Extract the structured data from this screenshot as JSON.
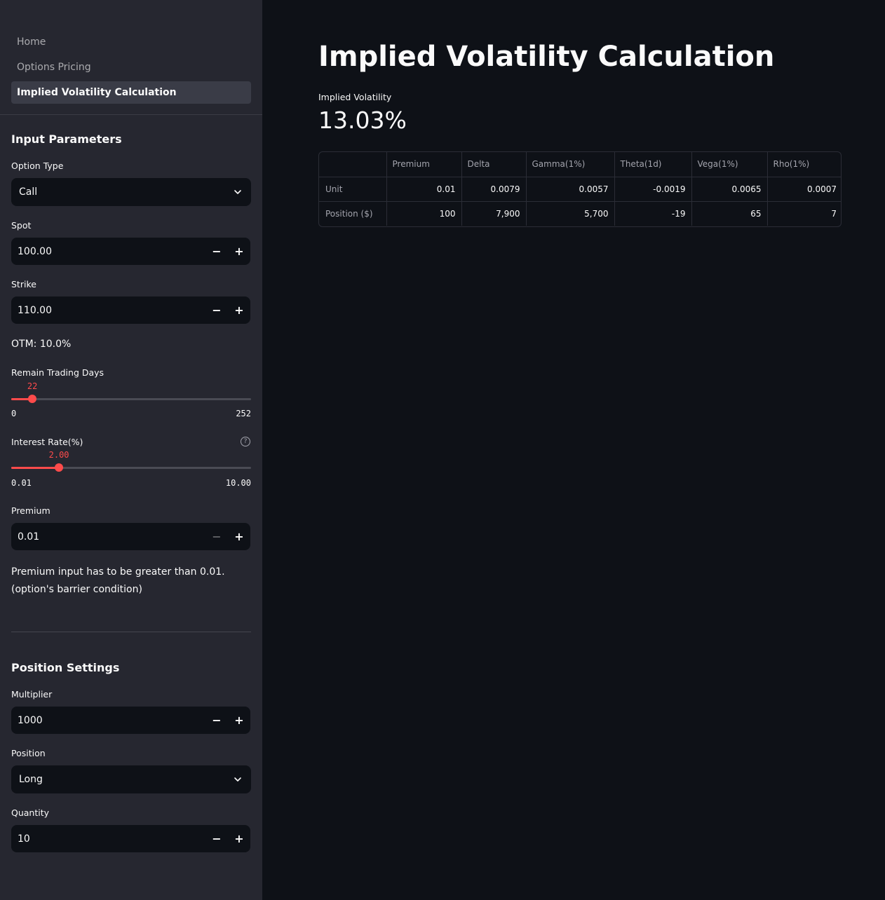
{
  "sidebar": {
    "nav": [
      {
        "label": "Home",
        "active": false
      },
      {
        "label": "Options Pricing",
        "active": false
      },
      {
        "label": "Implied Volatility Calculation",
        "active": true
      }
    ],
    "input_parameters_title": "Input Parameters",
    "option_type": {
      "label": "Option Type",
      "value": "Call"
    },
    "spot": {
      "label": "Spot",
      "value": "100.00"
    },
    "strike": {
      "label": "Strike",
      "value": "110.00"
    },
    "otm_text": "OTM: 10.0%",
    "remain_days": {
      "label": "Remain Trading Days",
      "value": "22",
      "min": "0",
      "max": "252",
      "fraction": 0.0873
    },
    "interest_rate": {
      "label": "Interest Rate(%)",
      "value": "2.00",
      "min": "0.01",
      "max": "10.00",
      "fraction": 0.1992
    },
    "premium": {
      "label": "Premium",
      "value": "0.01"
    },
    "premium_note_line1": "Premium input has to be greater than 0.01.",
    "premium_note_line2": "(option's barrier condition)",
    "position_settings_title": "Position Settings",
    "multiplier": {
      "label": "Multiplier",
      "value": "1000"
    },
    "position": {
      "label": "Position",
      "value": "Long"
    },
    "quantity": {
      "label": "Quantity",
      "value": "10"
    }
  },
  "main": {
    "title": "Implied Volatility Calculation",
    "metric_label": "Implied Volatility",
    "metric_value": "13.03%",
    "table": {
      "columns": [
        "",
        "Premium",
        "Delta",
        "Gamma(1%)",
        "Theta(1d)",
        "Vega(1%)",
        "Rho(1%)"
      ],
      "rows": [
        {
          "label": "Unit",
          "cells": [
            "0.01",
            "0.0079",
            "0.0057",
            "-0.0019",
            "0.0065",
            "0.0007"
          ]
        },
        {
          "label": "Position ($)",
          "cells": [
            "100",
            "7,900",
            "5,700",
            "-19",
            "65",
            "7"
          ]
        }
      ]
    }
  },
  "colors": {
    "accent": "#ff4b4b",
    "sidebar_bg": "#262730",
    "main_bg": "#0e1117"
  }
}
